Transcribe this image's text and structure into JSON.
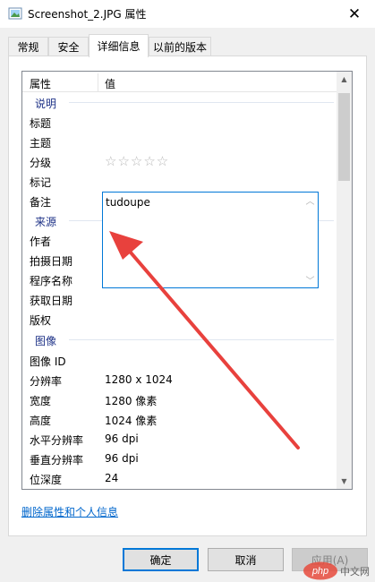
{
  "window": {
    "title": "Screenshot_2.JPG 属性",
    "close_glyph": "✕"
  },
  "tabs": [
    {
      "label": "常规"
    },
    {
      "label": "安全"
    },
    {
      "label": "详细信息"
    },
    {
      "label": "以前的版本"
    }
  ],
  "details": {
    "header_name": "属性",
    "header_value": "值",
    "groups": {
      "description": "说明",
      "origin": "来源",
      "image": "图像"
    },
    "rows": {
      "title": {
        "name": "标题",
        "value": ""
      },
      "subject": {
        "name": "主题",
        "value": ""
      },
      "rating": {
        "name": "分级",
        "value": "☆☆☆☆☆",
        "stars": 0
      },
      "tags": {
        "name": "标记",
        "value": ""
      },
      "comments": {
        "name": "备注",
        "value": "tudoupe"
      },
      "authors": {
        "name": "作者",
        "value": ""
      },
      "date_taken": {
        "name": "拍摄日期",
        "value": ""
      },
      "program_name": {
        "name": "程序名称",
        "value": ""
      },
      "date_acquired": {
        "name": "获取日期",
        "value": ""
      },
      "copyright": {
        "name": "版权",
        "value": ""
      },
      "image_id": {
        "name": "图像 ID",
        "value": ""
      },
      "dimensions": {
        "name": "分辨率",
        "value": "1280 x 1024"
      },
      "width": {
        "name": "宽度",
        "value": "1280 像素"
      },
      "height": {
        "name": "高度",
        "value": "1024 像素"
      },
      "h_resolution": {
        "name": "水平分辨率",
        "value": "96 dpi"
      },
      "v_resolution": {
        "name": "垂直分辨率",
        "value": "96 dpi"
      },
      "bit_depth": {
        "name": "位深度",
        "value": "24"
      }
    }
  },
  "remove_link": "删除属性和个人信息",
  "buttons": {
    "ok": "确定",
    "cancel": "取消",
    "apply": "应用(A)"
  },
  "watermark": "php 中文网",
  "annotation": {
    "arrow_color": "#e8413d"
  },
  "colors": {
    "accent": "#0078d7",
    "group_text": "#1e3287",
    "link": "#0066cc"
  }
}
